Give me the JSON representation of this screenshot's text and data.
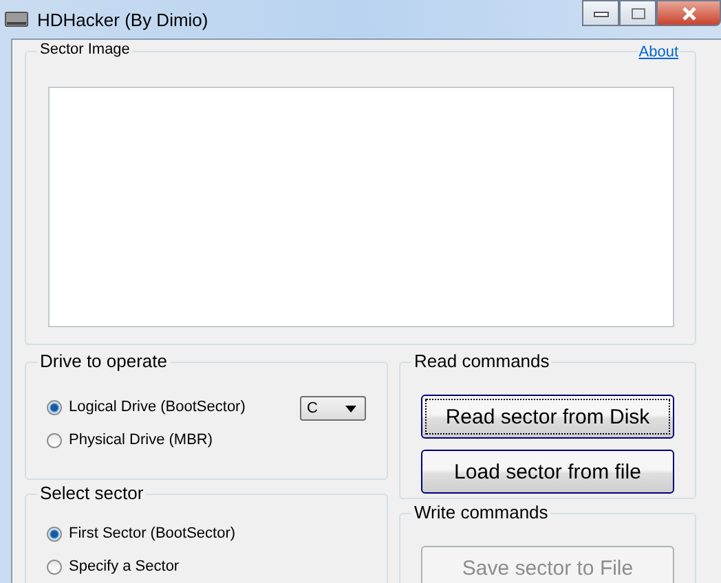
{
  "window": {
    "title": "HDHacker (By Dimio)"
  },
  "sector_image": {
    "title": "Sector Image",
    "about_link": "About"
  },
  "drive_to_operate": {
    "title": "Drive to operate",
    "drive": "C",
    "options": [
      {
        "label": "Logical Drive (BootSector)",
        "selected": true
      },
      {
        "label": "Physical Drive (MBR)",
        "selected": false
      }
    ]
  },
  "select_sector": {
    "title": "Select sector",
    "options": [
      {
        "label": "First Sector (BootSector)",
        "selected": true
      },
      {
        "label": "Specify a Sector",
        "selected": false
      }
    ]
  },
  "read_commands": {
    "title": "Read commands",
    "buttons": [
      {
        "label": "Read sector from Disk",
        "disabled": false,
        "focused": true
      },
      {
        "label": "Load sector from file",
        "disabled": false,
        "focused": false
      }
    ]
  },
  "write_commands": {
    "title": "Write commands",
    "buttons": [
      {
        "label": "Save sector to File",
        "disabled": true,
        "focused": false
      }
    ]
  }
}
